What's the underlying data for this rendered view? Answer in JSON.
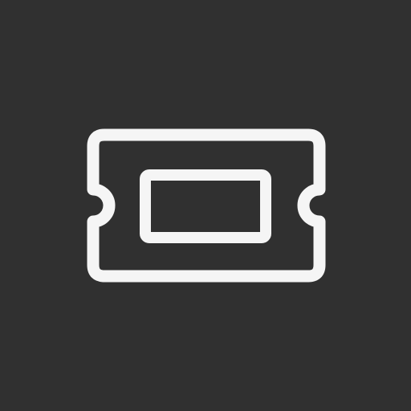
{
  "icon": {
    "name": "ticket-icon",
    "background_color": "#303030",
    "stroke_color": "#f5f5f5"
  }
}
